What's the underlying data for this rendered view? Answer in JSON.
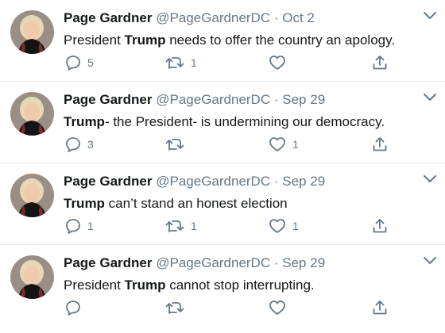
{
  "tweets": [
    {
      "name": "Page Gardner",
      "handle": "@PageGardnerDC",
      "separator": "·",
      "date": "Oct 2",
      "text_before": "President ",
      "text_bold": "Trump",
      "text_after": " needs to offer the country an apology.",
      "replies": "5",
      "retweets": "1",
      "likes": ""
    },
    {
      "name": "Page Gardner",
      "handle": "@PageGardnerDC",
      "separator": "·",
      "date": "Sep 29",
      "text_before": "",
      "text_bold": "Trump",
      "text_after": "- the President- is undermining our democracy.",
      "replies": "3",
      "retweets": "",
      "likes": "1"
    },
    {
      "name": "Page Gardner",
      "handle": "@PageGardnerDC",
      "separator": "·",
      "date": "Sep 29",
      "text_before": "",
      "text_bold": "Trump",
      "text_after": " can’t stand an honest election",
      "replies": "1",
      "retweets": "1",
      "likes": "1"
    },
    {
      "name": "Page Gardner",
      "handle": "@PageGardnerDC",
      "separator": "·",
      "date": "Sep 29",
      "text_before": "President ",
      "text_bold": "Trump",
      "text_after": " cannot stop interrupting.",
      "replies": "",
      "retweets": "",
      "likes": ""
    }
  ],
  "colors": {
    "icon": "#657786",
    "name": "#14171a",
    "divider": "#e6ecf0"
  },
  "icons": [
    "reply-icon",
    "retweet-icon",
    "like-icon",
    "share-icon",
    "chevron-down-icon"
  ]
}
